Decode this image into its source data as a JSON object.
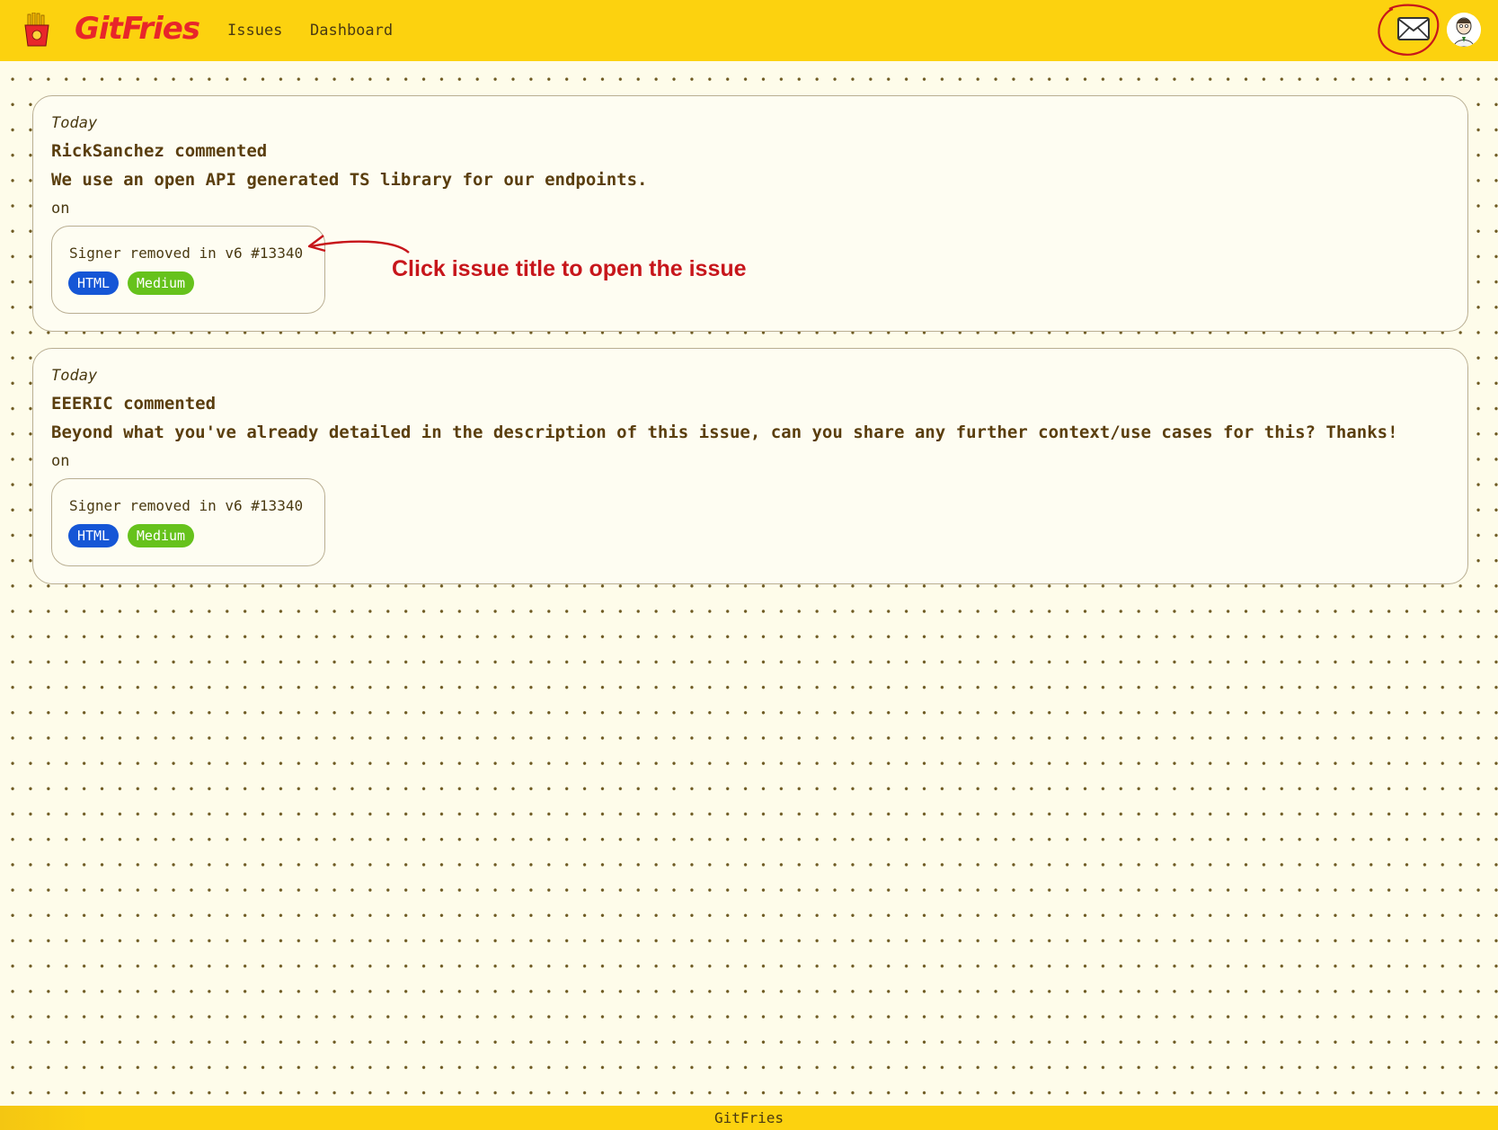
{
  "header": {
    "brand": "GitFries",
    "nav": [
      {
        "label": "Issues"
      },
      {
        "label": "Dashboard"
      }
    ]
  },
  "notifications": [
    {
      "date": "Today",
      "author_line": "RickSanchez commented",
      "comment": "We use an open API generated TS library for our endpoints.",
      "on_label": "on",
      "issue": {
        "title": "Signer removed in v6 #13340",
        "tags": [
          "HTML",
          "Medium"
        ]
      }
    },
    {
      "date": "Today",
      "author_line": "EEERIC commented",
      "comment": "Beyond what you've already detailed in the description of this issue, can you share any further context/use cases for this? Thanks!",
      "on_label": "on",
      "issue": {
        "title": "Signer removed in v6 #13340",
        "tags": [
          "HTML",
          "Medium"
        ]
      }
    }
  ],
  "annotation": {
    "text": "Click issue title to open the issue",
    "color": "#c7161b"
  },
  "footer": {
    "text": "GitFries"
  },
  "colors": {
    "topbar": "#fcd20f",
    "brand": "#e8262a",
    "tag_html": "#1556d6",
    "tag_medium": "#66c21c"
  }
}
